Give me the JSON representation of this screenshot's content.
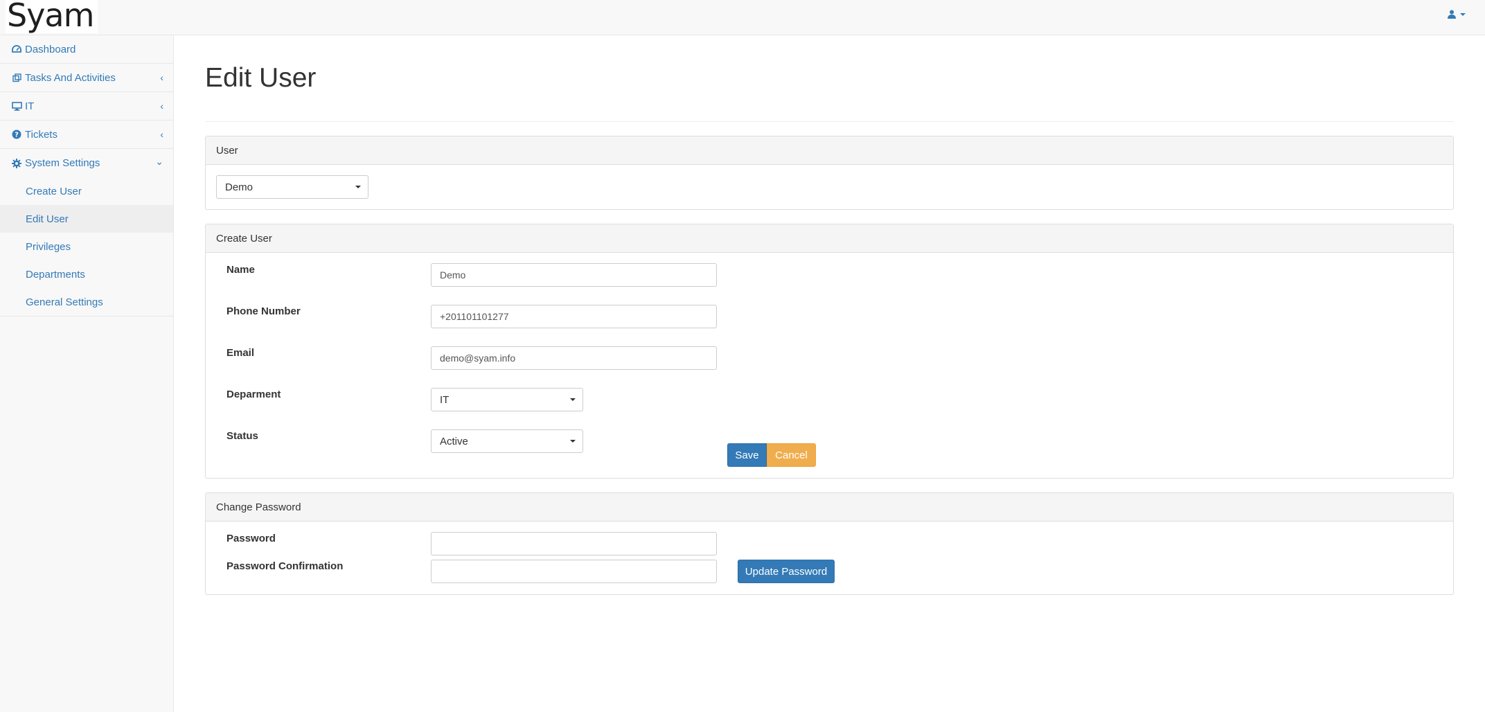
{
  "app": {
    "logo_text": "Syam"
  },
  "colors": {
    "primary": "#337ab7",
    "warning": "#f0ad4e",
    "logo_dot": "#2a35d9"
  },
  "sidebar": {
    "items": [
      {
        "label": "Dashboard",
        "icon": "dashboard-icon"
      },
      {
        "label": "Tasks And Activities",
        "icon": "clone-icon"
      },
      {
        "label": "IT",
        "icon": "desktop-icon"
      },
      {
        "label": "Tickets",
        "icon": "question-circle-icon"
      },
      {
        "label": "System Settings",
        "icon": "gear-icon"
      }
    ],
    "sub_items": [
      {
        "label": "Create User"
      },
      {
        "label": "Edit User"
      },
      {
        "label": "Privileges"
      },
      {
        "label": "Departments"
      },
      {
        "label": "General Settings"
      }
    ]
  },
  "page": {
    "title": "Edit User"
  },
  "user_panel": {
    "heading": "User",
    "selected_user": "Demo"
  },
  "create_panel": {
    "heading": "Create User",
    "name_label": "Name",
    "name_value": "Demo",
    "phone_label": "Phone Number",
    "phone_value": "+201101101277",
    "email_label": "Email",
    "email_value": "demo@syam.info",
    "department_label": "Deparment",
    "department_value": "IT",
    "status_label": "Status",
    "status_value": "Active",
    "save_label": "Save",
    "cancel_label": "Cancel"
  },
  "password_panel": {
    "heading": "Change Password",
    "password_label": "Password",
    "confirm_label": "Password Confirmation",
    "update_label": "Update Password"
  }
}
